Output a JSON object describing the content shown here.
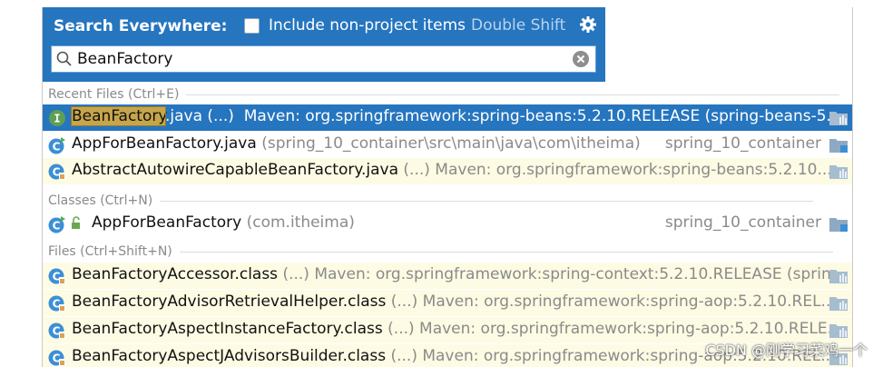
{
  "header": {
    "title": "Search Everywhere:",
    "include_label": "Include non-project items",
    "shortcut_hint": "Double Shift"
  },
  "search": {
    "value": "BeanFactory"
  },
  "sections": {
    "recent": "Recent Files (Ctrl+E)",
    "classes": "Classes (Ctrl+N)",
    "files": "Files (Ctrl+Shift+N)"
  },
  "rows": [
    {
      "highlight": "BeanFactory",
      "name_rest": ".java (...)",
      "meta": "Maven: org.springframework:spring-beans:5.2.10.RELEASE (spring-beans-5....",
      "right": ""
    },
    {
      "name": "AppForBeanFactory.java",
      "meta": "(spring_10_container\\src\\main\\java\\com\\itheima)",
      "right": "spring_10_container"
    },
    {
      "name": "AbstractAutowireCapableBeanFactory.java",
      "meta": "(...)  Maven: org.springframework:spring-beans:5.2.10...",
      "right": ""
    },
    {
      "name": "AppForBeanFactory",
      "meta": "(com.itheima)",
      "right": "spring_10_container"
    },
    {
      "name": "BeanFactoryAccessor.class",
      "meta": "(...)  Maven: org.springframework:spring-context:5.2.10.RELEASE (sprin...",
      "right": ""
    },
    {
      "name": "BeanFactoryAdvisorRetrievalHelper.class",
      "meta": "(...)  Maven: org.springframework:spring-aop:5.2.10.REL...",
      "right": ""
    },
    {
      "name": "BeanFactoryAspectInstanceFactory.class",
      "meta": "(...)  Maven: org.springframework:spring-aop:5.2.10.RELE...",
      "right": ""
    },
    {
      "name": "BeanFactoryAspectJAdvisorsBuilder.class",
      "meta": "(...)  Maven: org.springframework:spring-aop:5.2.10.REL...",
      "right": ""
    }
  ],
  "watermark": "CSDN @刚学习菜鸡一个",
  "colors": {
    "accent": "#2675bf",
    "highlight": "#c7a64b",
    "library_row": "#fdfbe3"
  }
}
